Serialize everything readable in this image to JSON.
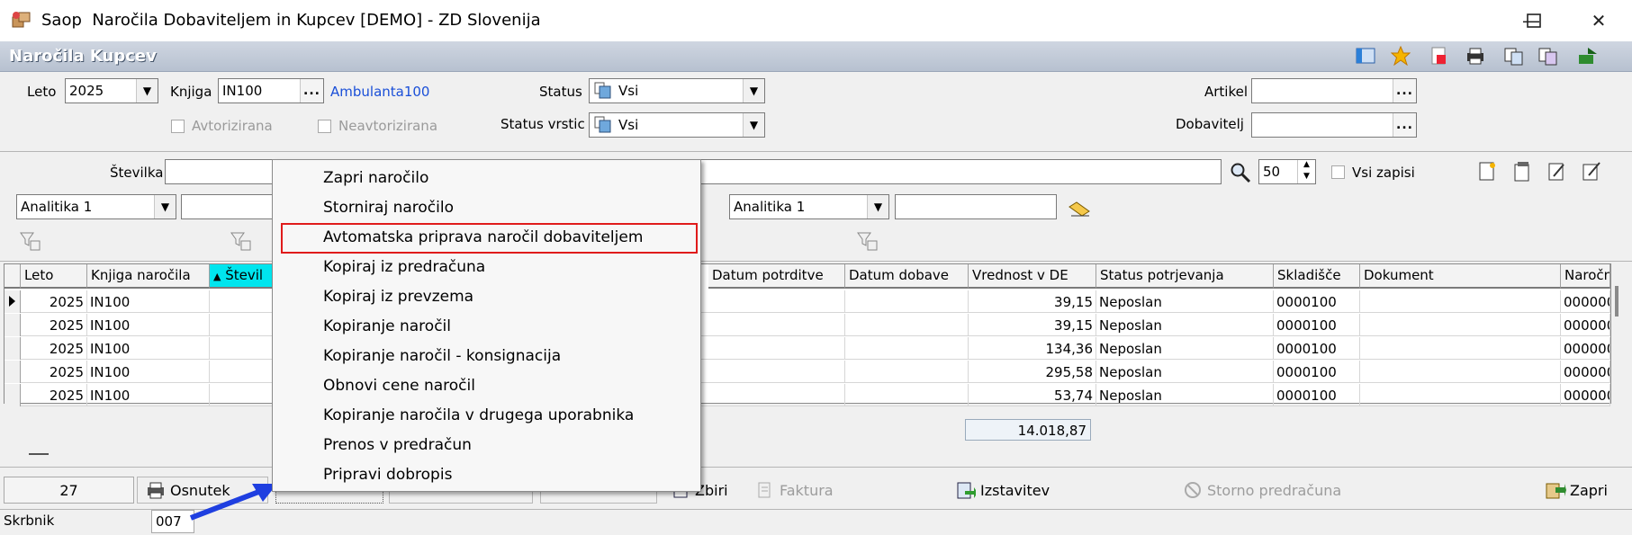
{
  "window": {
    "title": "Saop  Naročila Dobaviteljem in Kupcev [DEMO] - ZD Slovenija",
    "icon": "app-boxes-icon",
    "controls": [
      "minimize-icon",
      "maximize-icon",
      "close-icon"
    ]
  },
  "inner": {
    "title": "Naročila Kupcev"
  },
  "filters": {
    "leto_label": "Leto",
    "leto_value": "2025",
    "knjiga_label": "Knjiga",
    "knjiga_value": "IN100",
    "knjiga_link": "Ambulanta100",
    "avtorizirana_label": "Avtorizirana",
    "neavtorizirana_label": "Neavtorizirana",
    "status_label": "Status",
    "status_value": "Vsi",
    "status_vrstic_label": "Status vrstic",
    "status_vrstic_value": "Vsi",
    "artikel_label": "Artikel",
    "dobavitelj_label": "Dobavitelj",
    "stevilka_label": "Številka",
    "count_value": "50",
    "vsi_zapisi_label": "Vsi zapisi",
    "analitika_left": "Analitika 1",
    "analitika_right": "Analitika 1"
  },
  "grid": {
    "columns": [
      "Leto",
      "Knjiga naročila",
      "Števil",
      "Datum potrditve",
      "Datum dobave",
      "Vrednost v DE",
      "Status potrjevanja",
      "Skladišče",
      "Dokument",
      "Naročn"
    ],
    "sorted_column": "Števil",
    "rows": [
      {
        "leto": "2025",
        "knjiga": "IN100",
        "vrednost": "39,15",
        "status": "Neposlan",
        "skladisce": "0000100",
        "narocnik": "000000"
      },
      {
        "leto": "2025",
        "knjiga": "IN100",
        "vrednost": "39,15",
        "status": "Neposlan",
        "skladisce": "0000100",
        "narocnik": "000000"
      },
      {
        "leto": "2025",
        "knjiga": "IN100",
        "vrednost": "134,36",
        "status": "Neposlan",
        "skladisce": "0000100",
        "narocnik": "000000"
      },
      {
        "leto": "2025",
        "knjiga": "IN100",
        "vrednost": "295,58",
        "status": "Neposlan",
        "skladisce": "0000100",
        "narocnik": "000000"
      },
      {
        "leto": "2025",
        "knjiga": "IN100",
        "vrednost": "53,74",
        "status": "Neposlan",
        "skladisce": "0000100",
        "narocnik": "000000"
      }
    ],
    "total": "14.018,87"
  },
  "bottom": {
    "record_count": "27",
    "osnutek": "Osnutek",
    "zbiri": "Zbiri",
    "faktura": "Faktura",
    "izstavitev": "Izstavitev",
    "storno": "Storno predračuna",
    "zapri": "Zapri"
  },
  "status_bar": {
    "label": "Skrbnik",
    "value": "007"
  },
  "context_menu": {
    "items": [
      "Zapri naročilo",
      "Storniraj naročilo",
      "Avtomatska priprava naročil dobaviteljem",
      "Kopiraj iz predračuna",
      "Kopiraj iz prevzema",
      "Kopiranje naročil",
      "Kopiranje naročil - konsignacija",
      "Obnovi cene naročil",
      "Kopiranje naročila v drugega uporabnika",
      "Prenos v predračun",
      "Pripravi dobropis"
    ],
    "highlighted_index": 2,
    "highlight_color": "#e01b1b"
  },
  "colors": {
    "sorted_header": "#00e5ee",
    "link": "#1a4fd8",
    "annotation_arrow": "#1f3fe0"
  }
}
